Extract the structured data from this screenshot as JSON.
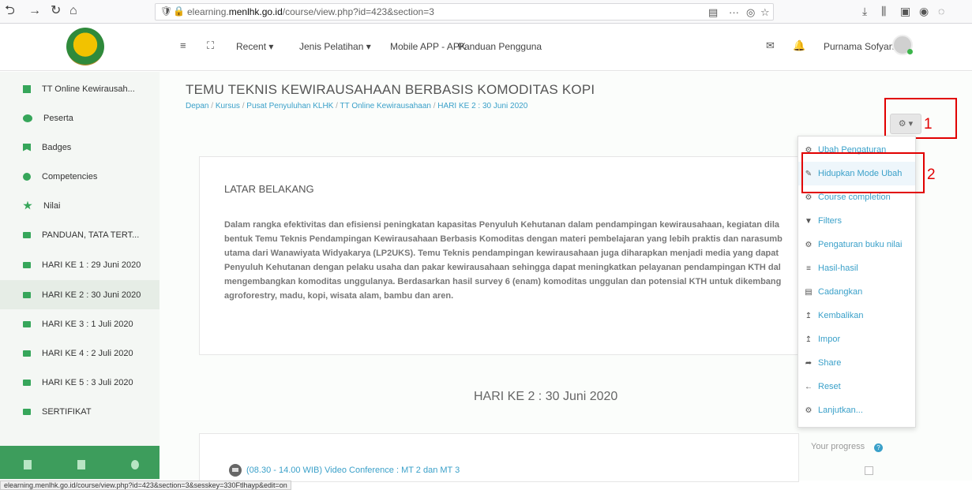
{
  "browser": {
    "url_prefix": "elearning.",
    "url_domain": "menlhk.go.id",
    "url_path": "/course/view.php?id=423&section=3",
    "status_url": "elearning.menlhk.go.id/course/view.php?id=423&section=3&sesskey=330Ftlhayp&edit=on"
  },
  "header": {
    "menu": [
      "Recent ▾",
      "Jenis Pelatihan ▾",
      "Mobile APP - APK",
      "Panduan Pengguna"
    ],
    "user_name": "Purnama Sofyan"
  },
  "sidebar": {
    "items": [
      {
        "label": "TT Online Kewirausah...",
        "icon": "course-icon"
      },
      {
        "label": "Peserta",
        "icon": "people-icon"
      },
      {
        "label": "Badges",
        "icon": "badge-icon"
      },
      {
        "label": "Competencies",
        "icon": "check-circle-icon"
      },
      {
        "label": "Nilai",
        "icon": "star-icon"
      },
      {
        "label": "PANDUAN, TATA TERT...",
        "icon": "folder-icon"
      },
      {
        "label": "HARI KE 1 : 29 Juni 2020",
        "icon": "folder-icon"
      },
      {
        "label": "HARI KE 2 : 30 Juni 2020",
        "icon": "folder-icon"
      },
      {
        "label": "HARI KE 3 : 1 Juli 2020",
        "icon": "folder-icon"
      },
      {
        "label": "HARI KE 4 : 2 Juli 2020",
        "icon": "folder-icon"
      },
      {
        "label": "HARI KE 5 : 3 Juli 2020",
        "icon": "folder-icon"
      },
      {
        "label": "SERTIFIKAT",
        "icon": "folder-icon"
      }
    ],
    "active_item": "HARI KE 2 : 30 Juni 2020"
  },
  "main": {
    "course_title": "TEMU TEKNIS KEWIRAUSAHAAN BERBASIS KOMODITAS KOPI",
    "breadcrumb": [
      "Depan",
      "Kursus",
      "Pusat Penyuluhan KLHK",
      "TT Online Kewirausahaan",
      "HARI KE 2 : 30 Juni 2020"
    ],
    "section_heading": "LATAR BELAKANG",
    "summary_lines": [
      "Dalam rangka efektivitas dan efisiensi peningkatan kapasitas Penyuluh Kehutanan dalam pendampingan kewirausahaan, kegiatan dila",
      "bentuk Temu Teknis Pendampingan Kewirausahaan Berbasis Komoditas dengan materi pembelajaran yang lebih praktis dan  narasumb",
      "utama dari Wanawiyata Widyakarya (LP2UKS). Temu Teknis pendampingan kewirausahaan juga diharapkan menjadi media yang dapat",
      "Penyuluh Kehutanan dengan pelaku usaha dan pakar kewirausahaan sehingga dapat meningkatkan pelayanan pendampingan KTH dal",
      "mengembangkan komoditas unggulanya. Berdasarkan hasil survey 6 (enam) komoditas unggulan dan potensial KTH untuk dikembang",
      "agroforestry, madu, kopi, wisata alam, bambu dan aren."
    ],
    "day_title": "HARI KE 2 : 30 Juni 2020",
    "activity_label": "(08.30 - 14.00 WIB) Video Conference : MT 2 dan MT 3",
    "progress_label": "Your progress"
  },
  "annotations": {
    "num1": "1",
    "num2": "2"
  },
  "dropdown": {
    "items": [
      {
        "label": "Ubah Pengaturan",
        "icon": "gear-icon"
      },
      {
        "label": "Hidupkan Mode Ubah",
        "icon": "pencil-icon"
      },
      {
        "label": "Course completion",
        "icon": "gear-icon"
      },
      {
        "label": "Filters",
        "icon": "filter-icon"
      },
      {
        "label": "Pengaturan buku nilai",
        "icon": "gear-icon"
      },
      {
        "label": "Hasil-hasil",
        "icon": "list-icon"
      },
      {
        "label": "Cadangkan",
        "icon": "file-icon"
      },
      {
        "label": "Kembalikan",
        "icon": "upload-icon"
      },
      {
        "label": "Impor",
        "icon": "upload-icon"
      },
      {
        "label": "Share",
        "icon": "share-icon"
      },
      {
        "label": "Reset",
        "icon": "arrow-left-icon"
      },
      {
        "label": "Lanjutkan...",
        "icon": "gear-icon"
      }
    ],
    "highlighted": "Hidupkan Mode Ubah"
  },
  "colors": {
    "accent_green": "#36a65a",
    "link_blue": "#3aa0c9",
    "annotation_red": "#e10000"
  }
}
